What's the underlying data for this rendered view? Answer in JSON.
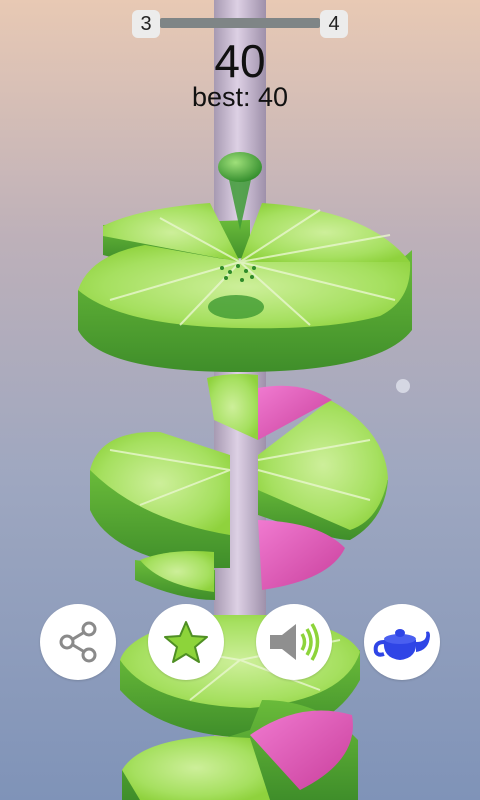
{
  "hud": {
    "current_level": "3",
    "next_level": "4",
    "level_progress": 0.0,
    "score": "40",
    "best": "best: 40"
  },
  "buttons": [
    {
      "name": "share-button",
      "icon": "share-icon"
    },
    {
      "name": "rate-button",
      "icon": "star-icon"
    },
    {
      "name": "sound-button",
      "icon": "speaker-icon"
    },
    {
      "name": "more-games-button",
      "icon": "teapot-icon"
    }
  ],
  "colors": {
    "lime": "#8fd63c",
    "lime_rind": "#58a832",
    "pink_danger": "#e04fb0",
    "pole": "#cbbbd4",
    "ball": "#4fae3a",
    "teapot": "#2f45e6"
  }
}
